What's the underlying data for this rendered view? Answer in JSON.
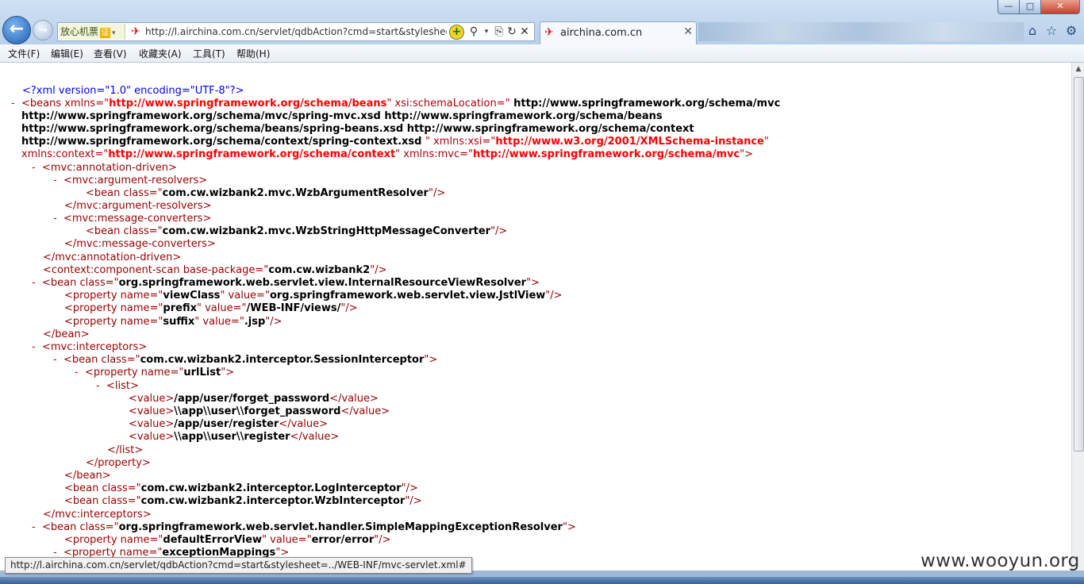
{
  "window": {
    "minimize": "—",
    "maximize": "□",
    "close": "✕"
  },
  "nav": {
    "back": "←",
    "forward": "→"
  },
  "address": {
    "badge_text": "放心机票",
    "badge_icon": "证",
    "url": "http://l.airchina.com.cn/servlet/qdbAction?cmd=start&stylesheet="
  },
  "tab": {
    "title": "airchina.com.cn"
  },
  "menu": {
    "file": "文件(F)",
    "edit": "编辑(E)",
    "view": "查看(V)",
    "favorites": "收藏夹(A)",
    "tools": "工具(T)",
    "help": "帮助(H)"
  },
  "xml": {
    "l0": "<?xml version=\"1.0\" encoding=\"UTF-8\"?>",
    "beans_minus": "-",
    "beans_open": "<beans",
    "xmlns_attr": " xmlns=\"",
    "xmlns_val": "http://www.springframework.org/schema/beans",
    "xsi_loc_attr": "\" xsi:schemaLocation=\"",
    "xsi_loc_1": " http://www.springframework.org/schema/mvc",
    "xsi_loc_2": "http://www.springframework.org/schema/mvc/spring-mvc.xsd http://www.springframework.org/schema/beans",
    "xsi_loc_3": "http://www.springframework.org/schema/beans/spring-beans.xsd http://www.springframework.org/schema/context",
    "xsi_loc_4": "http://www.springframework.org/schema/context/spring-context.xsd ",
    "xmlns_xsi_attr": "\" xmlns:xsi=\"",
    "xmlns_xsi_val": "http://www.w3.org/2001/XMLSchema-instance",
    "xmlns_ctx_attr": "xmlns:context=\"",
    "xmlns_ctx_val": "http://www.springframework.org/schema/context",
    "xmlns_mvc_attr": "\" xmlns:mvc=\"",
    "xmlns_mvc_val": "http://www.springframework.org/schema/mvc",
    "xmlns_mvc_close": "\">",
    "ann_open": "<mvc:annotation-driven>",
    "argres_open": "<mvc:argument-resolvers>",
    "bean1_a": "<bean class=\"",
    "bean1_v": "com.cw.wizbank2.mvc.WzbArgumentResolver",
    "bean1_c": "\"/>",
    "argres_close": "</mvc:argument-resolvers>",
    "msgconv_open": "<mvc:message-converters>",
    "bean2_a": "<bean class=\"",
    "bean2_v": "com.cw.wizbank2.mvc.WzbStringHttpMessageConverter",
    "bean2_c": "\"/>",
    "msgconv_close": "</mvc:message-converters>",
    "ann_close": "</mvc:annotation-driven>",
    "scan_a": "<context:component-scan base-package=\"",
    "scan_v": "com.cw.wizbank2",
    "scan_c": "\"/>",
    "vr_a": "<bean class=\"",
    "vr_v": "org.springframework.web.servlet.view.InternalResourceViewResolver",
    "vr_c": "\">",
    "p1_a": "<property name=\"",
    "p1_n": "viewClass",
    "p1_m": "\" value=\"",
    "p1_v": "org.springframework.web.servlet.view.JstlView",
    "p1_c": "\"/>",
    "p2_a": "<property name=\"",
    "p2_n": "prefix",
    "p2_m": "\" value=\"",
    "p2_v": "/WEB-INF/views/",
    "p2_c": "\"/>",
    "p3_a": "<property name=\"",
    "p3_n": "suffix",
    "p3_m": "\" value=\"",
    "p3_v": ".jsp",
    "p3_c": "\"/>",
    "bean_close": "</bean>",
    "int_open": "<mvc:interceptors>",
    "si_a": "<bean class=\"",
    "si_v": "com.cw.wizbank2.interceptor.SessionInterceptor",
    "si_c": "\">",
    "ul_a": "<property name=\"",
    "ul_v": "urlList",
    "ul_c": "\">",
    "list_open": "<list>",
    "val_open": "<value>",
    "val_close": "</value>",
    "v1": "/app/user/forget_password",
    "v2": "\\\\app\\\\user\\\\forget_password",
    "v3": "/app/user/register",
    "v4": "\\\\app\\\\user\\\\register",
    "list_close": "</list>",
    "prop_close": "</property>",
    "bean_close2": "</bean>",
    "li_a": "<bean class=\"",
    "li_v": "com.cw.wizbank2.interceptor.LogInterceptor",
    "li_c": "\"/>",
    "wi_a": "<bean class=\"",
    "wi_v": "com.cw.wizbank2.interceptor.WzbInterceptor",
    "wi_c": "\"/>",
    "int_close": "</mvc:interceptors>",
    "er_a": "<bean class=\"",
    "er_v": "org.springframework.web.servlet.handler.SimpleMappingExceptionResolver",
    "er_c": "\">",
    "de_a": "<property name=\"",
    "de_n": "defaultErrorView",
    "de_m": "\" value=\"",
    "de_v": "error/error",
    "de_c": "\"/>",
    "em_a": "<property name=\"",
    "em_n": "exceptionMappings",
    "em_c": "\">"
  },
  "status": {
    "tooltip": "http://l.airchina.com.cn/servlet/qdbAction?cmd=start&stylesheet=../WEB-INF/mvc-servlet.xml#"
  },
  "watermark": "www.wooyun.org"
}
